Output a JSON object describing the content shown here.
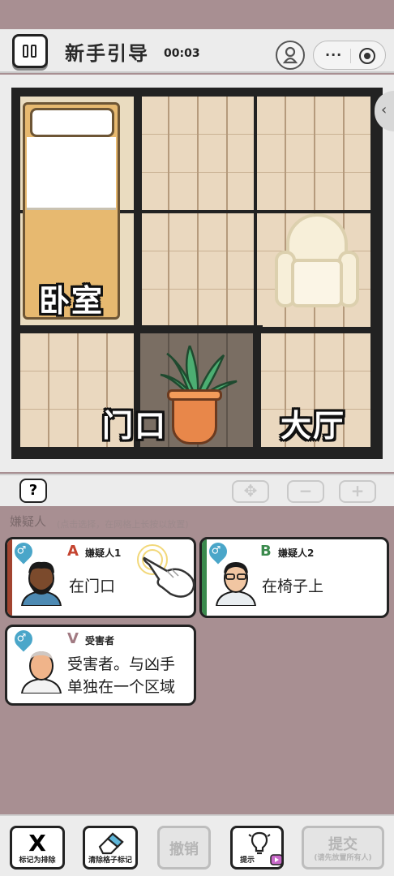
{
  "header": {
    "title": "新手引导",
    "timer": "00:03",
    "capsule_dots": "···"
  },
  "board": {
    "rooms": [
      {
        "id": "bedroom",
        "label": "卧室"
      },
      {
        "id": "doorway",
        "label": "门口"
      },
      {
        "id": "hall",
        "label": "大厅"
      }
    ],
    "side_tab_glyph": "‹"
  },
  "tools": {
    "help": "?",
    "move": "✥",
    "zoom_out": "−",
    "zoom_in": "+"
  },
  "suspects_section": {
    "title": "嫌疑人",
    "hint": "(点击选择，在网格上长按以放置)"
  },
  "cards": [
    {
      "letter": "A",
      "letter_color": "#c4432f",
      "role": "嫌疑人1",
      "clue": "在门口",
      "gender": "♂",
      "stripe_color": "#a2432f"
    },
    {
      "letter": "B",
      "letter_color": "#3b8a4d",
      "role": "嫌疑人2",
      "clue": "在椅子上",
      "gender": "♂",
      "stripe_color": "#3b8a4d"
    },
    {
      "letter": "V",
      "letter_color": "#a17a82",
      "role": "受害者",
      "clue_line1": "受害者。与凶手",
      "clue_line2": "单独在一个区域",
      "gender": "♂",
      "stripe_color": "#ffffff"
    }
  ],
  "bottom_bar": {
    "mark_exclude": {
      "main": "X",
      "sub": "标记为排除"
    },
    "clear_marks": {
      "sub": "清除格子标记"
    },
    "undo": {
      "main": "撤销"
    },
    "hint": {
      "sub": "提示"
    },
    "submit": {
      "main": "提交",
      "sub": "(请先放置所有人)"
    }
  },
  "colors": {
    "background": "#a88f92",
    "panel": "#ececec",
    "wood": "#ead8bf",
    "pot": "#e8874a",
    "gender_badge": "#4aa6c9"
  }
}
